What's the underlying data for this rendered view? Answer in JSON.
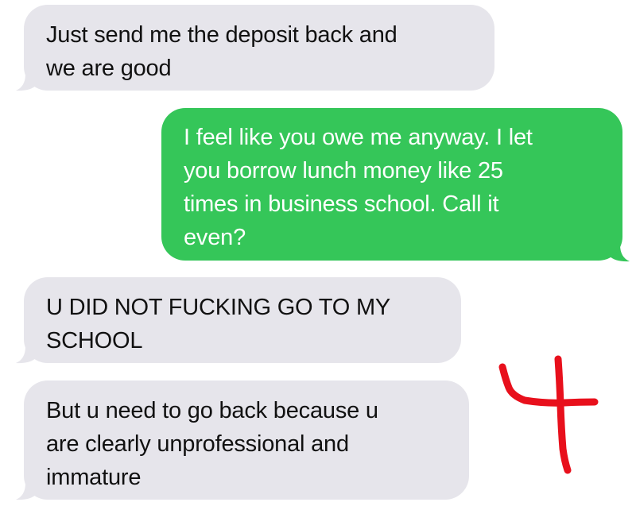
{
  "thread": {
    "messages": [
      {
        "from": "them",
        "lines": [
          "Just send me the deposit back and",
          "we are good"
        ]
      },
      {
        "from": "me",
        "lines": [
          "I feel like you owe me anyway. I let",
          "you borrow lunch money like 25",
          "times in business school. Call it",
          "even?"
        ]
      },
      {
        "from": "them",
        "lines": [
          "U DID NOT FUCKING GO TO MY",
          "SCHOOL"
        ]
      },
      {
        "from": "them",
        "lines": [
          "But u need to go back because u",
          "are clearly unprofessional and",
          "immature"
        ]
      }
    ],
    "annotation": {
      "text": "4",
      "color": "#e8101c"
    }
  },
  "colors": {
    "received_bubble": "#e6e5eb",
    "sent_bubble": "#35c659"
  }
}
